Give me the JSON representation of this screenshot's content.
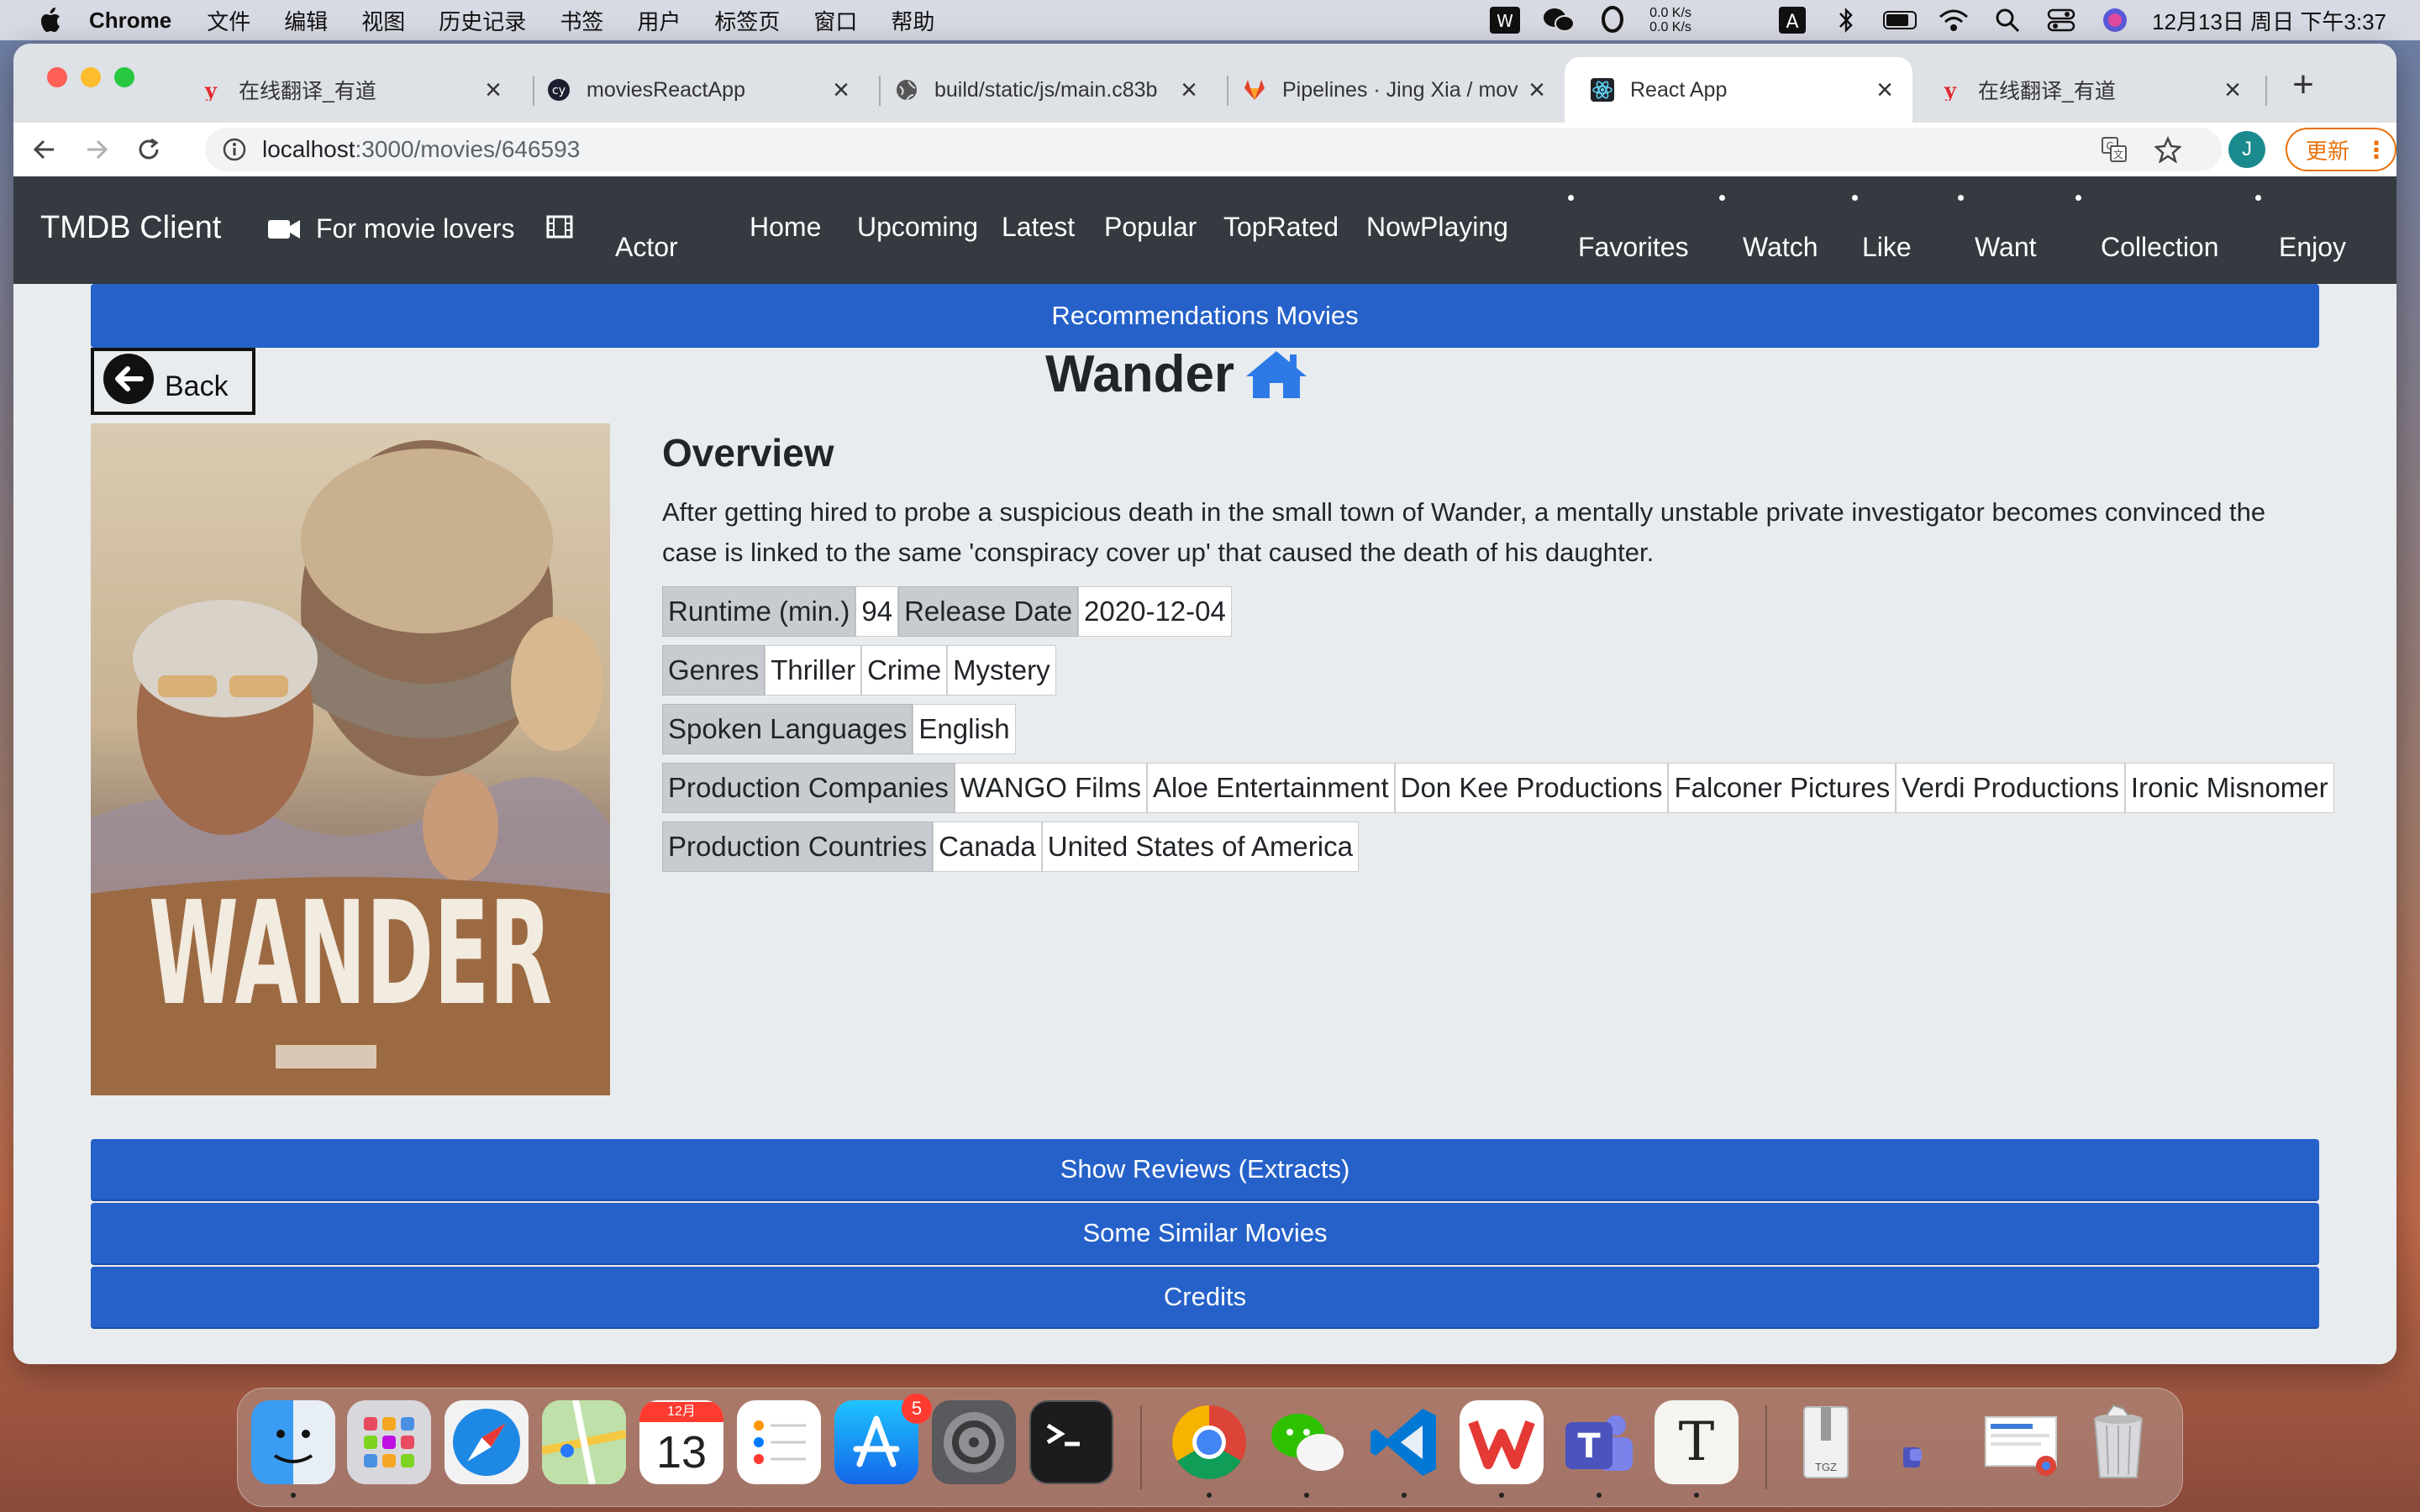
{
  "menubar": {
    "app_name": "Chrome",
    "menus": [
      "文件",
      "编辑",
      "视图",
      "历史记录",
      "书签",
      "用户",
      "标签页",
      "窗口",
      "帮助"
    ],
    "net_up": "0.0 K/s",
    "net_down": "0.0 K/s",
    "clock": "12月13日 周日 下午3:37"
  },
  "tabs": [
    {
      "title": "在线翻译_有道",
      "icon": "youdao-icon"
    },
    {
      "title": "moviesReactApp",
      "icon": "cypress-icon"
    },
    {
      "title": "build/static/js/main.c83b",
      "icon": "globe-icon"
    },
    {
      "title": "Pipelines · Jing Xia / mov",
      "icon": "gitlab-icon"
    },
    {
      "title": "React App",
      "icon": "react-icon",
      "active": true
    },
    {
      "title": "在线翻译_有道",
      "icon": "youdao-icon"
    }
  ],
  "address": {
    "host": "localhost",
    "path": ":3000/movies/646593"
  },
  "profile_initial": "J",
  "update_label": "更新",
  "app_nav": {
    "brand": "TMDB Client",
    "tagline": "For movie lovers",
    "links": {
      "actor": "Actor",
      "home": "Home",
      "upcoming": "Upcoming",
      "latest": "Latest",
      "popular": "Popular",
      "toprated": "TopRated",
      "nowplaying": "NowPlaying",
      "favorites": "Favorites",
      "watch": "Watch",
      "like": "Like",
      "want": "Want",
      "collection": "Collection",
      "enjoy": "Enjoy"
    }
  },
  "movie": {
    "recommendations_label": "Recommendations Movies",
    "back_label": "Back",
    "title": "Wander",
    "poster_text": "WANDER",
    "overview_heading": "Overview",
    "overview": "After getting hired to probe a suspicious death in the small town of Wander, a mentally unstable private investigator becomes convinced the case is linked to the same 'conspiracy cover up' that caused the death of his daughter.",
    "runtime_label": "Runtime (min.)",
    "runtime": "94",
    "release_label": "Release Date",
    "release_date": "2020-12-04",
    "genres_label": "Genres",
    "genres": [
      "Thriller",
      "Crime",
      "Mystery"
    ],
    "languages_label": "Spoken Languages",
    "languages": [
      "English"
    ],
    "companies_label": "Production Companies",
    "companies": [
      "WANGO Films",
      "Aloe Entertainment",
      "Don Kee Productions",
      "Falconer Pictures",
      "Verdi Productions",
      "Ironic Misnomer"
    ],
    "countries_label": "Production Countries",
    "countries": [
      "Canada",
      "United States of America"
    ],
    "reviews_label": "Show Reviews (Extracts)",
    "similar_label": "Some Similar Movies",
    "credits_label": "Credits"
  },
  "dock": {
    "calendar_month": "12月",
    "calendar_day": "13",
    "appstore_badge": "5",
    "textedit_glyph": "T",
    "archive_label": "TGZ"
  },
  "colors": {
    "nav_bg": "#343a40",
    "accent_blue": "#2561c9",
    "page_bg": "#e9ecef"
  }
}
